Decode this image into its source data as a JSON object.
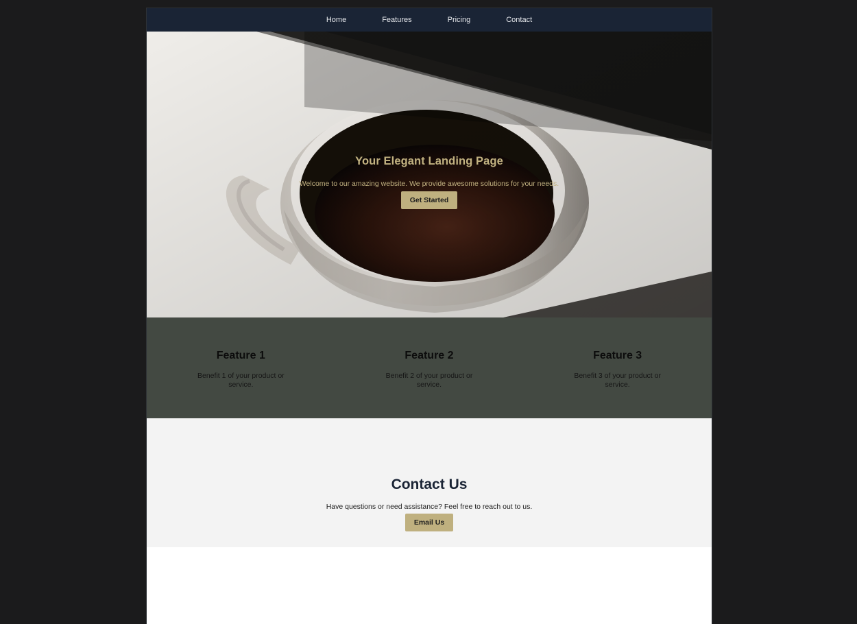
{
  "nav": {
    "items": [
      {
        "label": "Home"
      },
      {
        "label": "Features"
      },
      {
        "label": "Pricing"
      },
      {
        "label": "Contact"
      }
    ]
  },
  "hero": {
    "title": "Your Elegant Landing Page",
    "subtitle": "Welcome to our amazing website. We provide awesome solutions for your needs.",
    "cta_label": "Get Started",
    "background_image": "coffee cup on table with diagonal shadow"
  },
  "features": [
    {
      "title": "Feature 1",
      "text": "Benefit 1 of your product or service."
    },
    {
      "title": "Feature 2",
      "text": "Benefit 2 of your product or service."
    },
    {
      "title": "Feature 3",
      "text": "Benefit 3 of your product or service."
    }
  ],
  "contact": {
    "title": "Contact Us",
    "text": "Have questions or need assistance? Feel free to reach out to us.",
    "cta_label": "Email Us"
  },
  "colors": {
    "page_background": "#1b1b1c",
    "nav_background": "#1a2435",
    "accent": "#bfb07f",
    "features_background": "#434942",
    "contact_background": "#f3f3f3"
  }
}
